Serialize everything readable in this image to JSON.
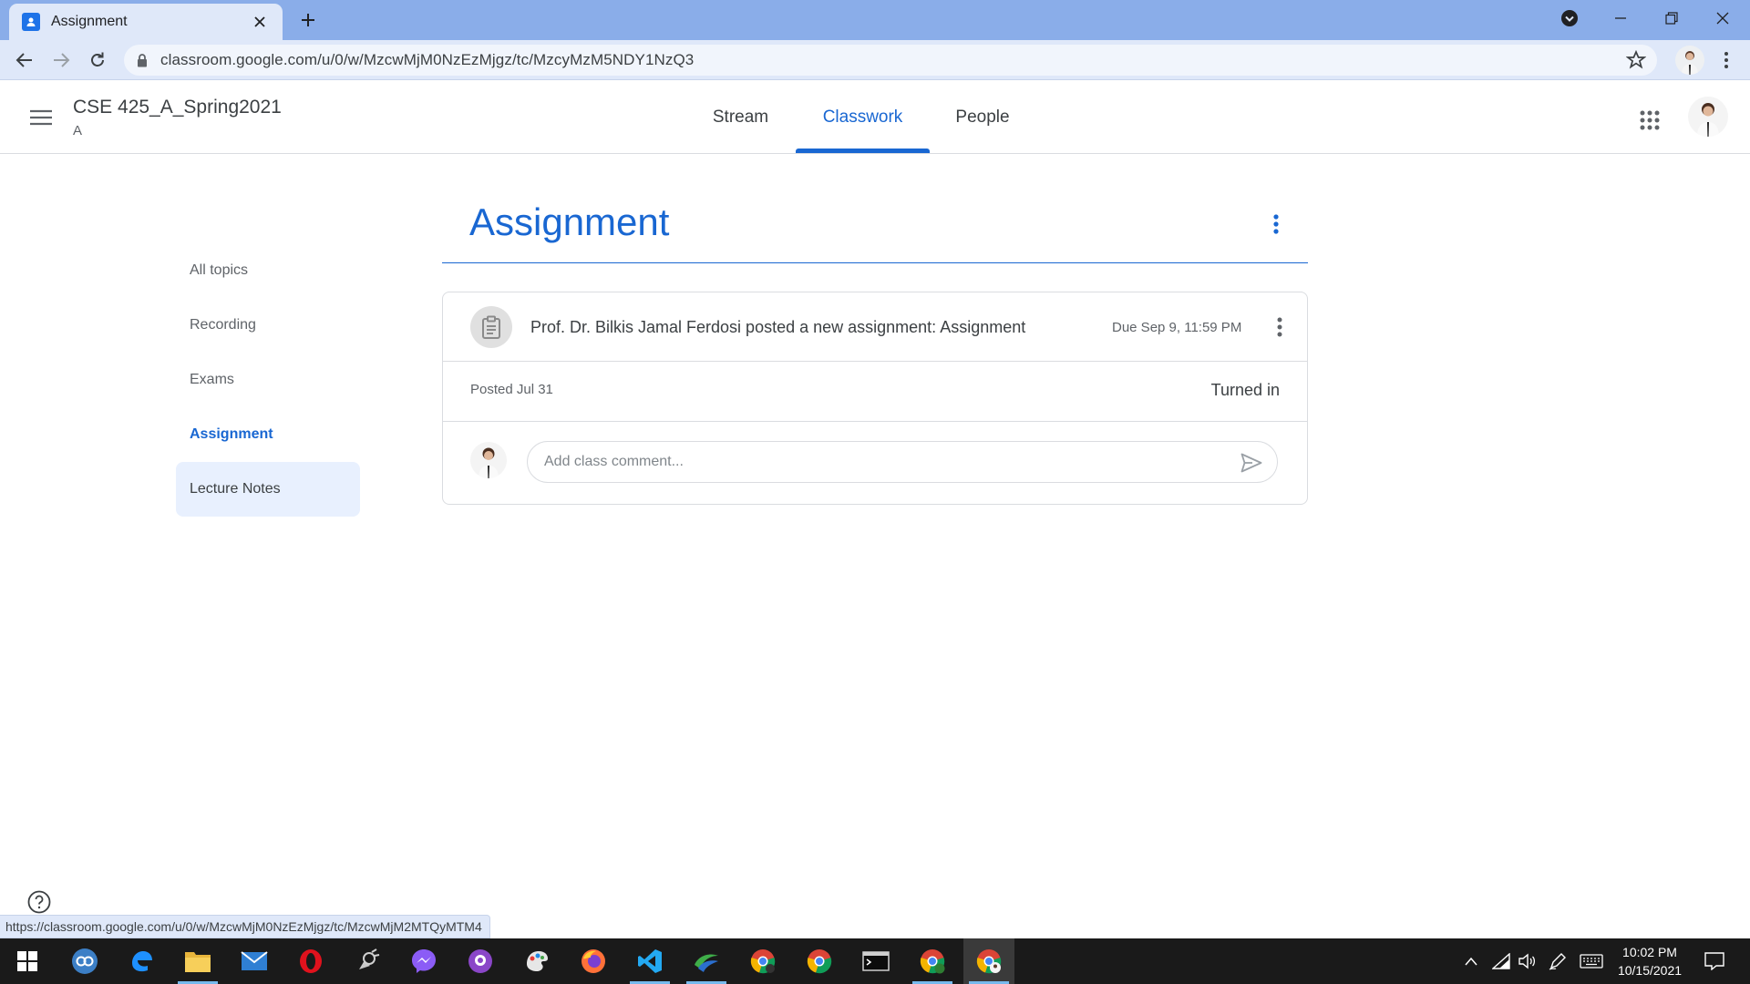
{
  "browser": {
    "tab_title": "Assignment",
    "url": "classroom.google.com/u/0/w/MzcwMjM0NzEzMjgz/tc/MzcyMzM5NDY1NzQ3",
    "status_url": "https://classroom.google.com/u/0/w/MzcwMjM0NzEzMjgz/tc/MzcwMjM2MTQyMTM4"
  },
  "header": {
    "class_name": "CSE 425_A_Spring2021",
    "section": "A",
    "tabs": [
      {
        "label": "Stream",
        "active": false
      },
      {
        "label": "Classwork",
        "active": true
      },
      {
        "label": "People",
        "active": false
      }
    ]
  },
  "sidebar": {
    "topics": [
      {
        "label": "All topics",
        "state": "normal"
      },
      {
        "label": "Recording",
        "state": "normal"
      },
      {
        "label": "Exams",
        "state": "normal"
      },
      {
        "label": "Assignment",
        "state": "active"
      },
      {
        "label": "Lecture Notes",
        "state": "hover"
      }
    ]
  },
  "main": {
    "section_title": "Assignment",
    "card": {
      "title": "Prof. Dr. Bilkis Jamal Ferdosi posted a new assignment: Assignment",
      "due": "Due Sep 9, 11:59 PM",
      "posted": "Posted Jul 31",
      "status": "Turned in",
      "comment_placeholder": "Add class comment..."
    }
  },
  "taskbar": {
    "apps": [
      "start-icon",
      "quickbooks-icon",
      "edge-icon",
      "file-explorer-icon",
      "mail-icon",
      "opera-icon",
      "satellite-app-icon",
      "messenger-icon",
      "github-desktop-icon",
      "paint-icon",
      "firefox-icon",
      "vscode-icon",
      "earth-icon",
      "chrome-profile-icon",
      "chrome-icon",
      "terminal-icon",
      "chrome-ek-icon",
      "chrome-current-icon"
    ],
    "time": "10:02 PM",
    "date": "10/15/2021"
  },
  "colors": {
    "accent": "#1967d2",
    "tabbar": "#8aade9",
    "toolbar": "#dfe8f9",
    "taskbar": "#1a1a1a"
  }
}
